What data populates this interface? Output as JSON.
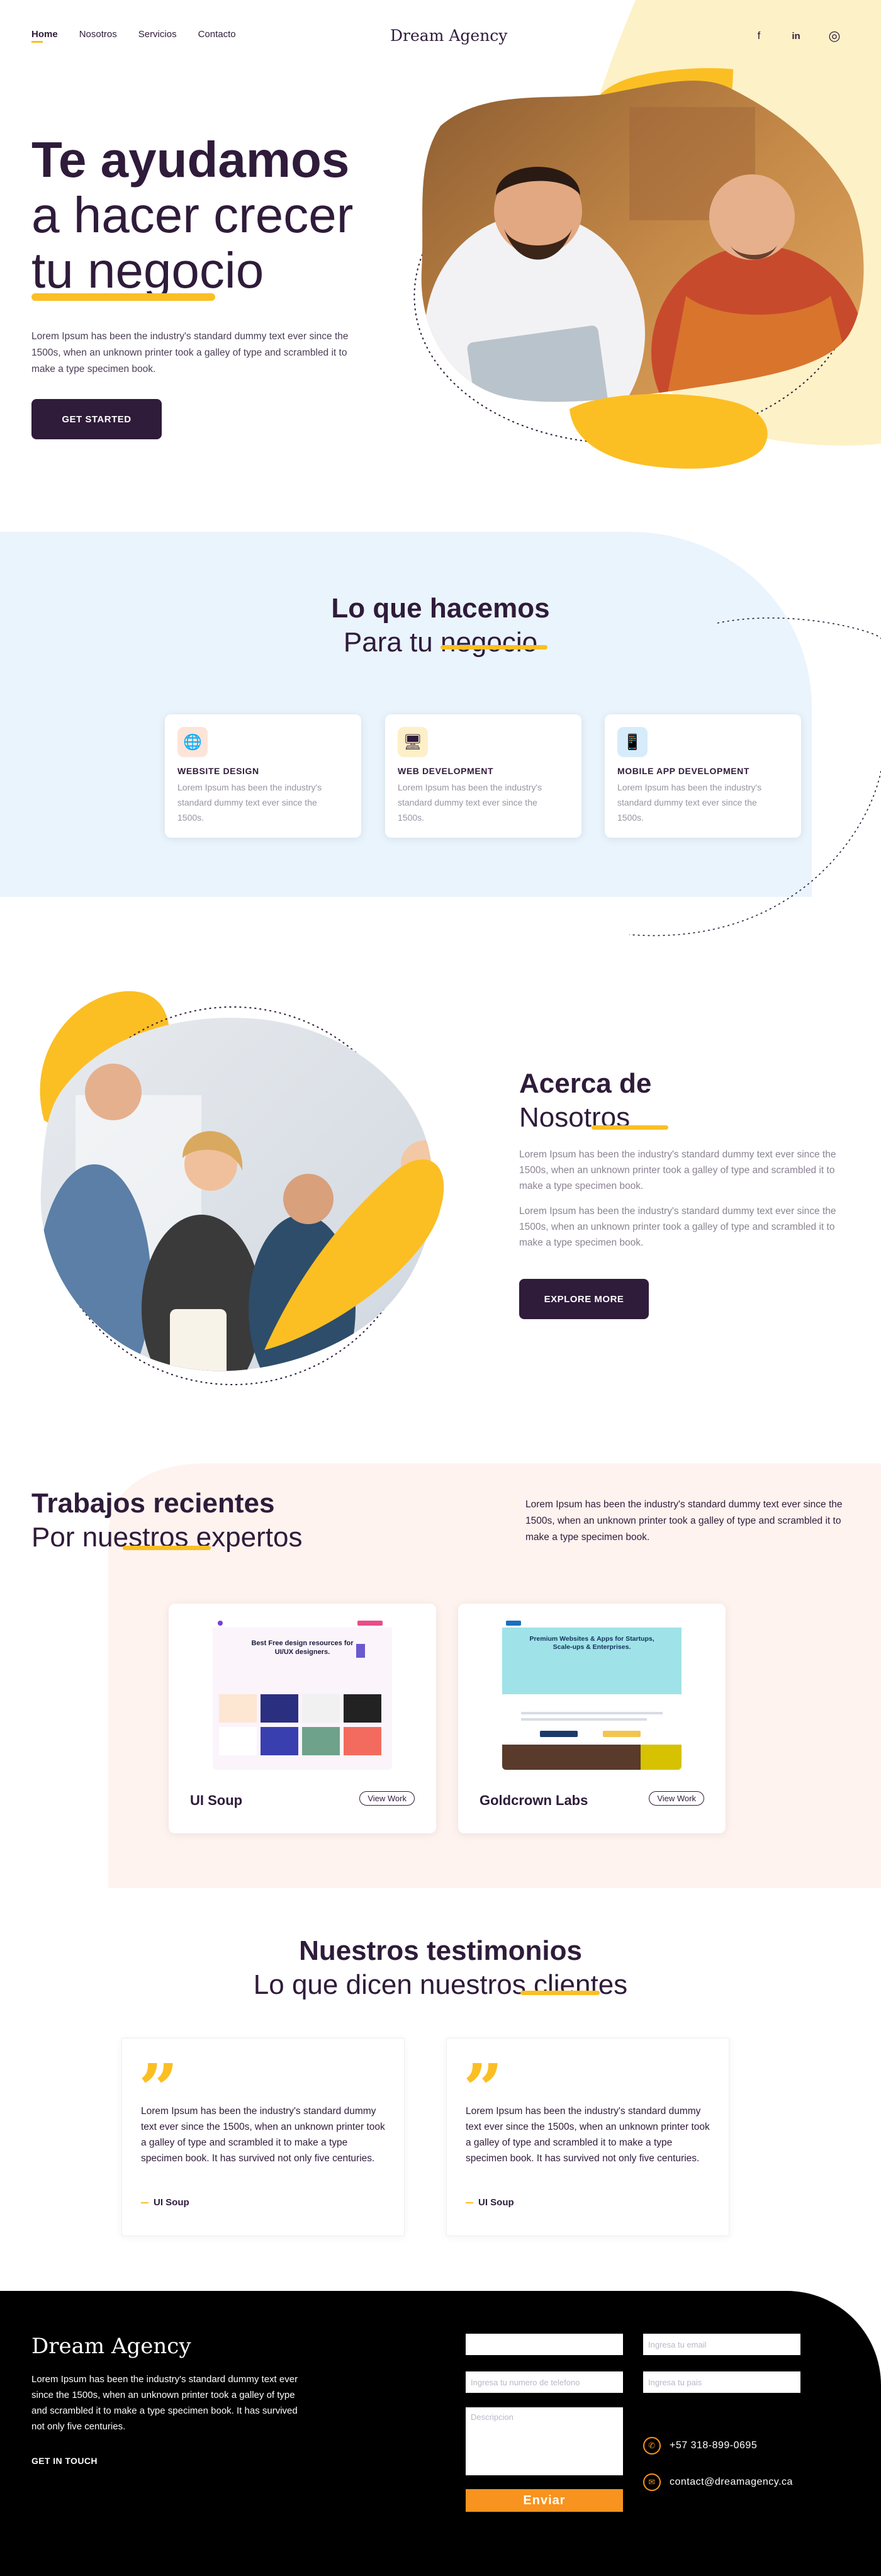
{
  "header": {
    "nav": [
      "Home",
      "Nosotros",
      "Servicios",
      "Contacto"
    ],
    "logo": "Dream Agency",
    "social": {
      "facebook": "f",
      "linkedin": "in",
      "instagram": "◎"
    }
  },
  "hero": {
    "title_bold": "Te ayudamos",
    "title_line2": "a hacer crecer",
    "title_line3": "tu negocio",
    "text": "Lorem Ipsum has been the industry's standard dummy text ever since the 1500s, when an unknown printer took a galley of type and scrambled it to make a type specimen book.",
    "cta": "GET STARTED"
  },
  "services": {
    "title_bold": "Lo que hacemos",
    "title_normal": "Para tu negocio",
    "cards": [
      {
        "title": "WEBSITE DESIGN",
        "text": "Lorem Ipsum has been the industry's standard dummy text ever since the 1500s.",
        "icon": "globe-icon",
        "icon_glyph": "🌐",
        "bg": "#fde4d9"
      },
      {
        "title": "WEB DEVELOPMENT",
        "text": "Lorem Ipsum has been the industry's standard dummy text ever since the 1500s.",
        "icon": "monitor-code-icon",
        "icon_glyph": "🖥",
        "bg": "#fdefc8"
      },
      {
        "title": "MOBILE APP DEVELOPMENT",
        "text": "Lorem Ipsum has been the industry's standard dummy text ever since the 1500s.",
        "icon": "mobile-icon",
        "icon_glyph": "📱",
        "bg": "#d6ecfb"
      }
    ]
  },
  "about": {
    "title_bold": "Acerca de",
    "title_normal": "Nosotros",
    "p1": "Lorem Ipsum has been the industry's standard dummy text ever since the 1500s, when an unknown printer took a galley of type and scrambled it to make a type specimen book.",
    "p2": "Lorem Ipsum has been the industry's standard dummy text ever since the 1500s, when an unknown printer took a galley of type and scrambled it to make a type specimen book.",
    "cta": "EXPLORE MORE"
  },
  "works": {
    "title_bold": "Trabajos recientes",
    "title_normal": "Por nuestros expertos",
    "text": "Lorem Ipsum has been the industry's standard dummy text ever since the 1500s, when an unknown printer took a galley of type and scrambled it to make a type specimen book.",
    "items": [
      {
        "name": "UI Soup",
        "button": "View Work",
        "shot_heading": "Best Free design resources for UI/UX designers."
      },
      {
        "name": "Goldcrown Labs",
        "button": "View Work",
        "shot_heading": "Premium Websites & Apps for Startups, Scale-ups & Enterprises."
      }
    ]
  },
  "testimonials": {
    "title_bold": "Nuestros testimonios",
    "title_normal": "Lo que dicen nuestros clientes",
    "items": [
      {
        "text": "Lorem Ipsum has been the industry's standard dummy text ever since the 1500s, when an unknown printer took a galley of type and scrambled it to make a type specimen book. It has survived not only five centuries.",
        "author": "UI Soup"
      },
      {
        "text": "Lorem Ipsum has been the industry's standard dummy text ever since the 1500s, when an unknown printer took a galley of type and scrambled it to make a type specimen book. It has survived not only five centuries.",
        "author": "UI Soup"
      }
    ]
  },
  "footer": {
    "logo": "Dream Agency",
    "text": "Lorem Ipsum has been the industry's standard dummy text ever since the 1500s, when an unknown printer took a galley of type and scrambled it to make a type specimen book. It has survived not only five centuries.",
    "link": "GET IN TOUCH",
    "form": {
      "name_placeholder": "",
      "email_placeholder": "Ingresa tu email",
      "phone_placeholder": "Ingresa tu numero de telefono",
      "country_placeholder": "Ingresa tu pais",
      "desc_placeholder": "Descripcion",
      "send": "Enviar"
    },
    "phone": "+57 318-899-0695",
    "email": "contact@dreamagency.ca"
  },
  "colors": {
    "accent": "#fbbf24",
    "dark": "#2f1b3a",
    "orange": "#f7931e",
    "light_blue": "#eaf4fd",
    "light_peach": "#fef3ef"
  }
}
